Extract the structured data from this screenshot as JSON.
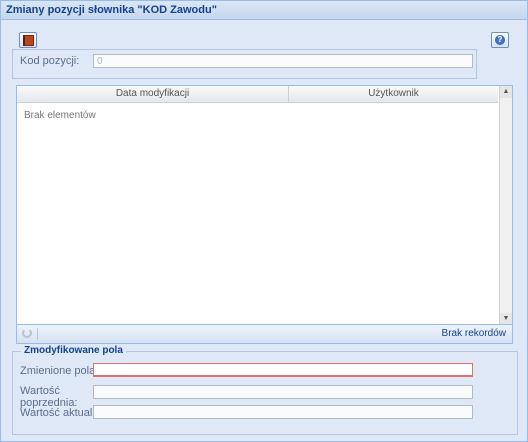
{
  "window": {
    "title": "Zmiany pozycji słownika \"KOD Zawodu\""
  },
  "toolbar": {
    "book_icon": "book-icon",
    "help_icon": "help-icon"
  },
  "form": {
    "kod_label": "Kod pozycji:",
    "kod_value": "0"
  },
  "grid": {
    "columns": [
      "Data modyfikacji",
      "Użytkownik"
    ],
    "empty_text": "Brak elementów",
    "pager_text": "Brak rekordów"
  },
  "modified": {
    "legend": "Zmodyfikowane pola",
    "changed_label": "Zmienione pola:",
    "prev_label_1": "Wartość",
    "prev_label_2": "poprzednia:",
    "current_label": "Wartość aktualna:"
  }
}
